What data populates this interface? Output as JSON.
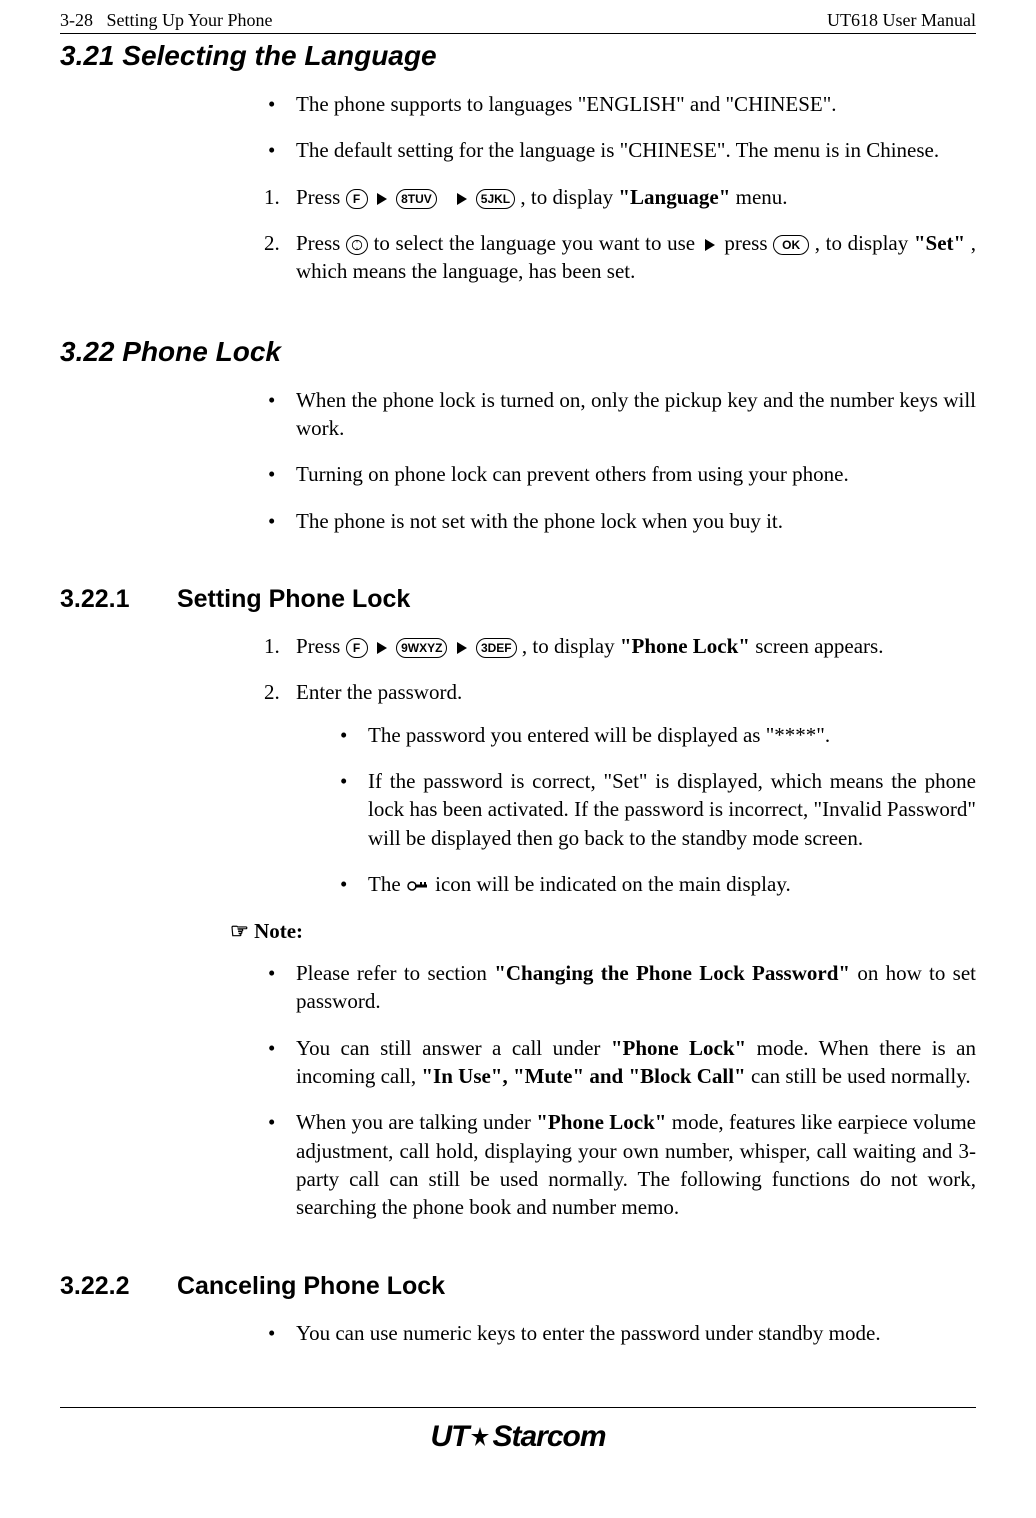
{
  "header": {
    "page_num": "3-28",
    "section_name": "Setting Up Your Phone",
    "manual_title": "UT618 User Manual"
  },
  "s321": {
    "title": "3.21 Selecting the Language",
    "b1": "The phone supports to languages \"ENGLISH\" and \"CHINESE\".",
    "b2": "The default setting for the language is \"CHINESE\". The menu is in Chinese.",
    "step1_a": "Press ",
    "step1_b": ", to display ",
    "step1_c": "\"Language\"",
    "step1_d": " menu.",
    "step2_a": "Press ",
    "step2_b": " to select the language you want to use ",
    "step2_c": " press ",
    "step2_d": ", to display ",
    "step2_e": "\"Set\"",
    "step2_f": ", which means the language, has been set."
  },
  "s322": {
    "title": "3.22 Phone Lock",
    "b1": "When the phone lock is turned on, only the pickup key and the number keys will work.",
    "b2": "Turning on phone lock can prevent others from using your phone.",
    "b3": "The phone is not set with the phone lock when you buy it."
  },
  "s3221": {
    "num": "3.22.1",
    "title": "Setting Phone Lock",
    "step1_a": "Press ",
    "step1_b": " , to display ",
    "step1_c": "\"Phone Lock\"",
    "step1_d": " screen appears.",
    "step2": "Enter the password.",
    "sub1": "The password you entered will be displayed as \"****\".",
    "sub2": "If the password is correct, \"Set\" is displayed, which means the phone lock has been activated. If the password is incorrect, \"Invalid Password\" will be displayed then go back to the standby mode screen.",
    "sub3_a": "The ",
    "sub3_b": " icon will be indicated on the main display.",
    "note_label": "☞ Note:",
    "note1_a": "Please refer to section ",
    "note1_b": "\"Changing the Phone Lock Password\"",
    "note1_c": " on how to set password.",
    "note2_a": "You can still answer a call under ",
    "note2_b": "\"Phone Lock\"",
    "note2_c": " mode. When there is an incoming call, ",
    "note2_d": "\"In Use\", \"Mute\" and \"Block Call\"",
    "note2_e": " can still be used normally.",
    "note3_a": "When you are talking under ",
    "note3_b": "\"Phone Lock\"",
    "note3_c": " mode, features like earpiece volume adjustment, call hold, displaying your own number, whisper, call waiting and 3-party call can still be used normally. The following functions do not work, searching the phone book and number memo."
  },
  "s3222": {
    "num": "3.22.2",
    "title": "Canceling Phone Lock",
    "b1": "You can use numeric keys to enter the password under standby mode."
  },
  "keys": {
    "F": "F",
    "k8": "8TUV",
    "k5": "5JKL",
    "k9": "9WXYZ",
    "k3": "3DEF",
    "OK": "OK"
  },
  "footer": {
    "brand_ut": "UT",
    "brand_rest": "Starcom"
  }
}
